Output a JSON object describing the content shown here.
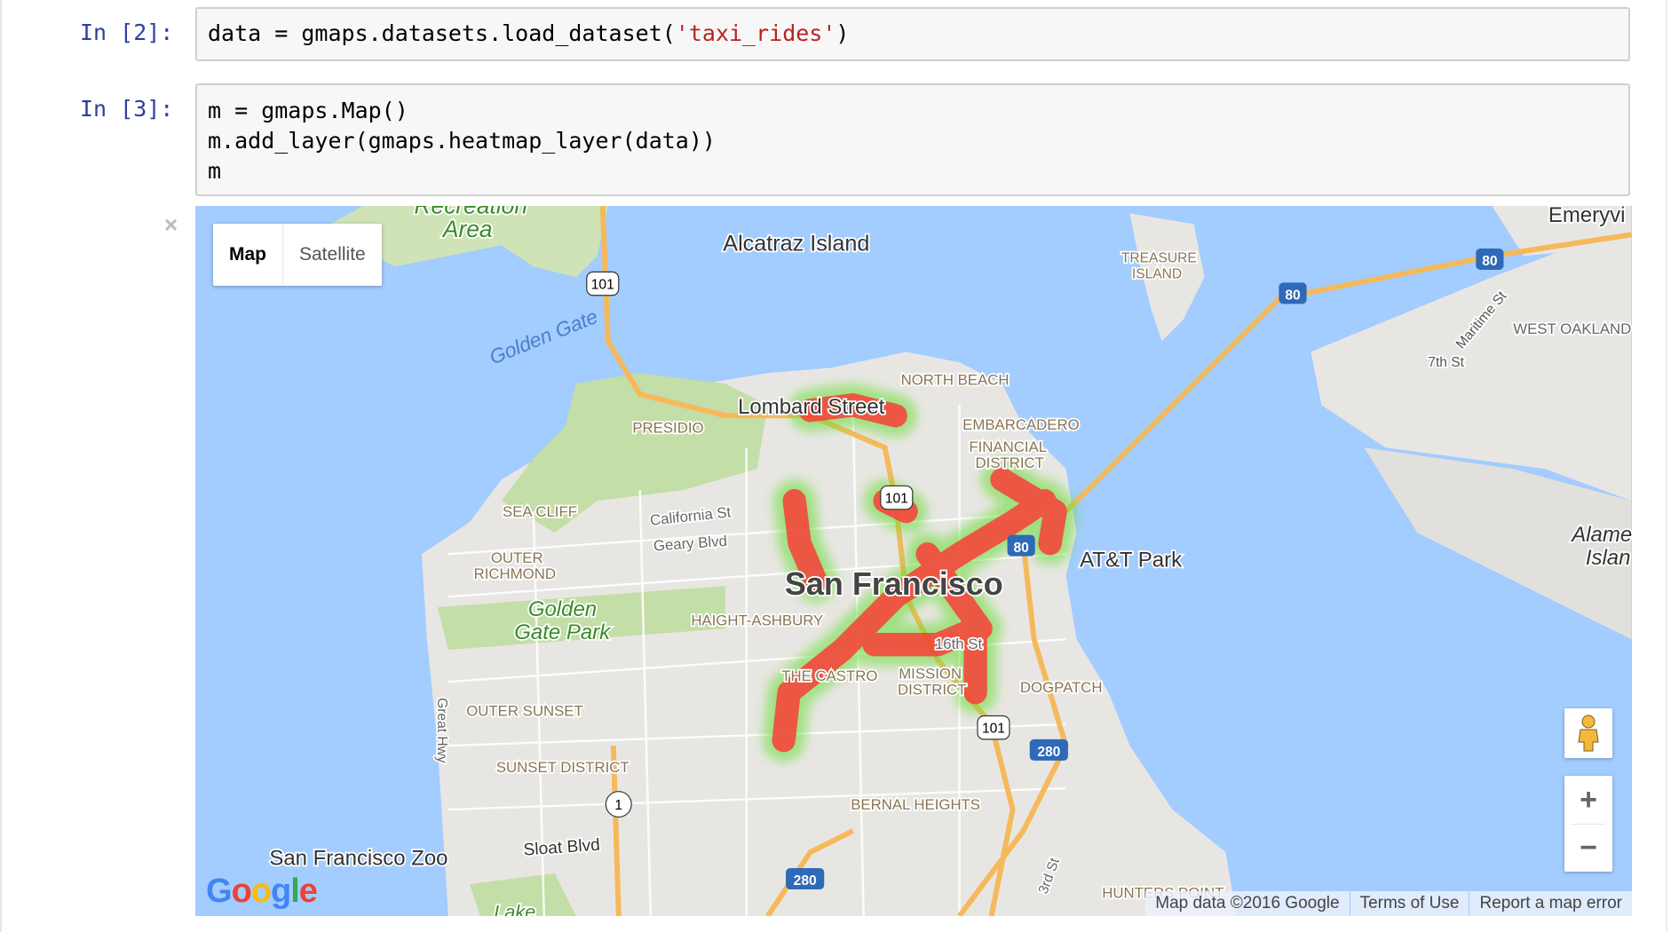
{
  "cells": [
    {
      "prompt": "In [2]:",
      "code_before": "data = gmaps.datasets.load_dataset(",
      "code_string": "'taxi_rides'",
      "code_after": ")"
    },
    {
      "prompt": "In [3]:",
      "lines": [
        "m = gmaps.Map()",
        "m.add_layer(gmaps.heatmap_layer(data))",
        "m"
      ]
    }
  ],
  "output": {
    "close_icon": "×",
    "map_type": {
      "map": "Map",
      "satellite": "Satellite",
      "selected": "Map"
    },
    "labels": {
      "recreation": "Recreation",
      "area": "Area",
      "alcatraz": "Alcatraz Island",
      "golden_gate": "Golden Gate",
      "treasure": "TREASURE",
      "island": "ISLAND",
      "emeryville": "Emeryvi",
      "west_oakland": "WEST OAKLAND",
      "maritime": "Maritime St",
      "seventh": "7th St",
      "north_beach": "NORTH BEACH",
      "lombard": "Lombard Street",
      "presidio": "PRESIDIO",
      "embarcadero": "EMBARCADERO",
      "financial": "FINANCIAL",
      "district": "DISTRICT",
      "sea_cliff": "SEA CLIFF",
      "california": "California St",
      "geary": "Geary Blvd",
      "outer": "OUTER",
      "richmond": "RICHMOND",
      "att_park": "AT&T Park",
      "san_francisco": "San Francisco",
      "golden": "Golden",
      "gate_park": "Gate Park",
      "haight": "HAIGHT-ASHBURY",
      "sixteenth": "16th St",
      "castro": "THE CASTRO",
      "mission": "MISSION",
      "mission_district": "DISTRICT",
      "dogpatch": "DOGPATCH",
      "outer_sunset": "OUTER SUNSET",
      "great_hwy": "Great Hwy",
      "sunset_district": "SUNSET DISTRICT",
      "bernal": "BERNAL HEIGHTS",
      "zoo": "San Francisco Zoo",
      "sloat": "Sloat Blvd",
      "hunters": "HUNTERS POINT",
      "third": "3rd St",
      "lake": "Lake",
      "alameda": "Alame",
      "alameda2": "Islan"
    },
    "shields": {
      "us101": "101",
      "i80": "80",
      "i280": "280",
      "ca1": "1"
    },
    "footer": {
      "map_data": "Map data ©2016 Google",
      "terms": "Terms of Use",
      "report": "Report a map error"
    },
    "logo": "Google",
    "zoom_in": "+",
    "zoom_out": "−",
    "colors": {
      "water": "#a3ccff",
      "land": "#e8e6e3",
      "park": "#c3dea6",
      "highway": "#f5b95c",
      "heat_high": "#ff3030",
      "heat_low": "#66dd33"
    }
  }
}
